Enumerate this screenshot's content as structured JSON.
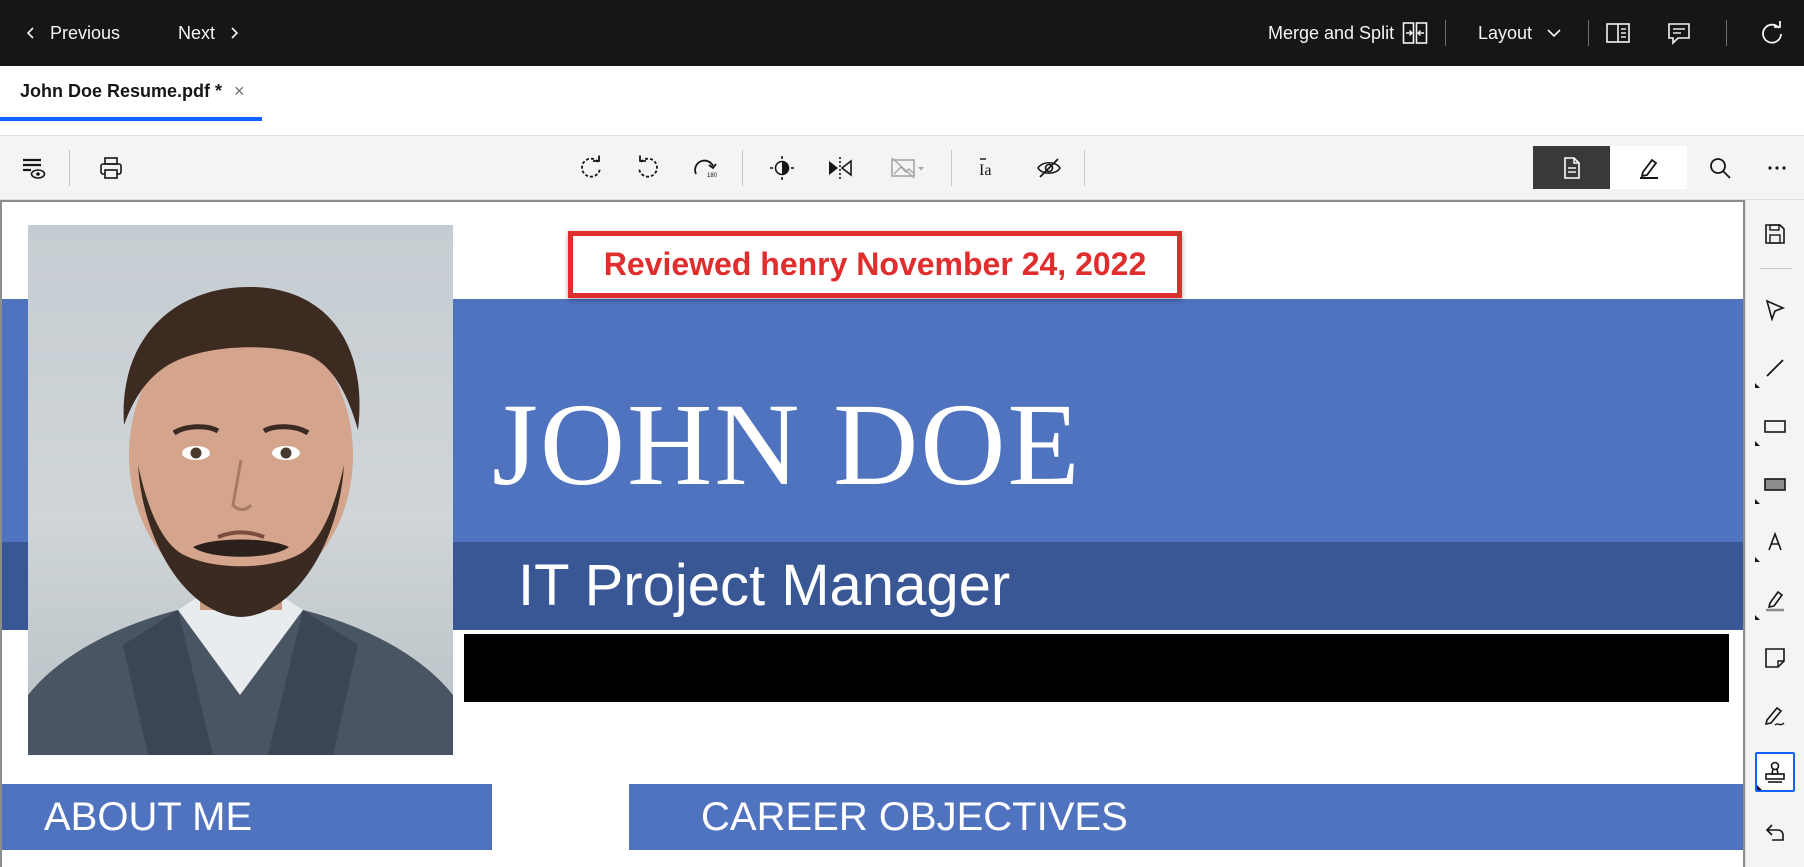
{
  "topbar": {
    "previous_label": "Previous",
    "next_label": "Next",
    "merge_label": "Merge and Split",
    "layout_label": "Layout"
  },
  "tab": {
    "title": "John Doe Resume.pdf *",
    "close_glyph": "×"
  },
  "toolbar": {
    "icons": [
      "annotation-visibility-icon",
      "print-icon",
      "rotate-clockwise-icon",
      "rotate-counterclockwise-icon",
      "rotate-180-icon",
      "contrast-icon",
      "flip-icon",
      "image-menu-icon",
      "text-recognition-icon",
      "hide-icon"
    ],
    "modes": [
      "view-mode-icon",
      "annotate-mode-icon"
    ],
    "right_icons": [
      "search-icon",
      "overflow-menu-icon"
    ]
  },
  "document": {
    "stamp_text": "Reviewed henry November 24, 2022",
    "name": "JOHN DOE",
    "job_title": "IT Project Manager",
    "about_heading": "ABOUT ME",
    "career_heading": "CAREER OBJECTIVES"
  },
  "rail": {
    "items": [
      "save-icon",
      "select-icon",
      "line-icon",
      "rectangle-icon",
      "filled-rectangle-icon",
      "text-icon",
      "highlight-icon",
      "sticky-note-icon",
      "freehand-icon",
      "stamp-icon",
      "undo-icon"
    ],
    "selected": "stamp-icon"
  },
  "colors": {
    "topbar_bg": "#161616",
    "accent_blue": "#0f62fe",
    "resume_blue": "#4f73bf",
    "resume_dark_blue": "#3a5795",
    "stamp_red": "#e02d2d"
  }
}
